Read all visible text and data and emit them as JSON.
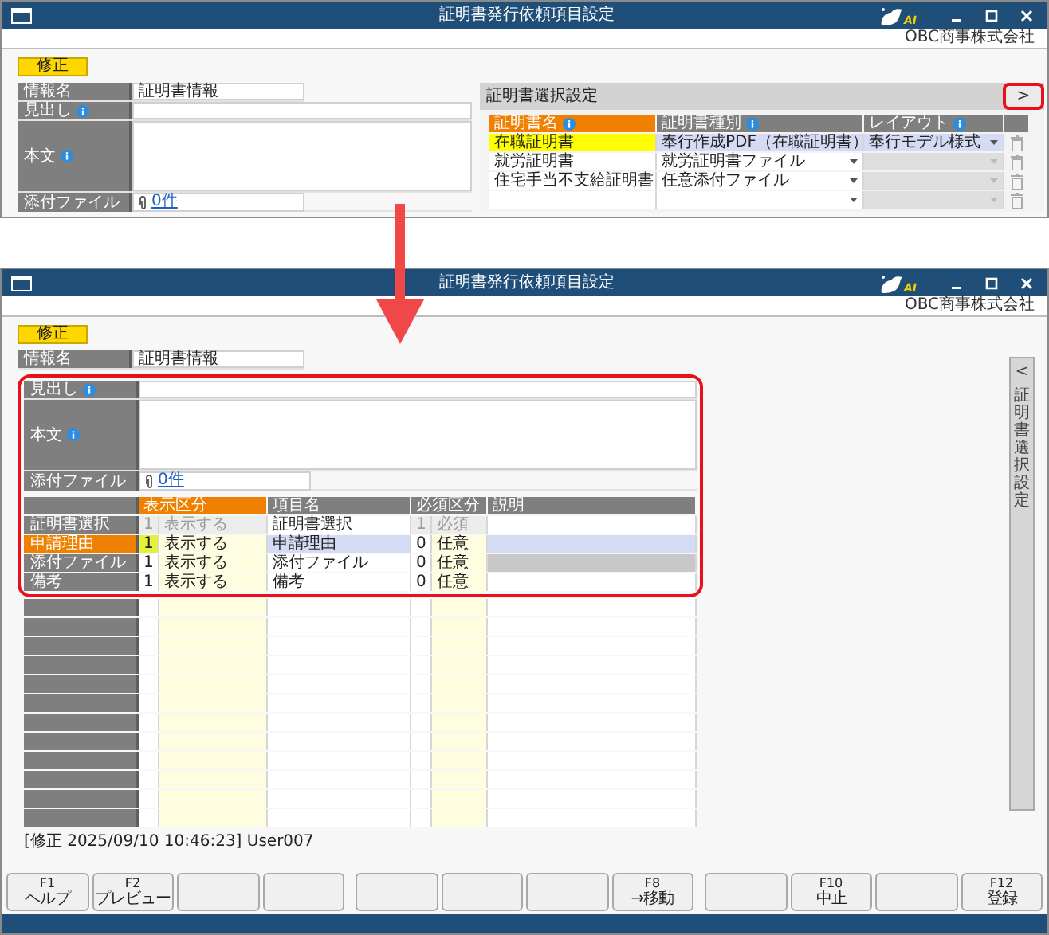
{
  "top_window": {
    "title": "証明書発行依頼項目設定",
    "ai_label": "AI",
    "company": "OBC商事株式会社",
    "mode": "修正",
    "fields": [
      {
        "kind": "name",
        "label": "情報名",
        "value": "証明書情報"
      },
      {
        "kind": "line",
        "label": "見出し",
        "info": true
      },
      {
        "kind": "memo",
        "label": "本文",
        "info": true
      },
      {
        "kind": "attachment",
        "label": "添付ファイル",
        "link": "0件"
      }
    ],
    "side_panel": {
      "title": "証明書選択設定",
      "toggle": ">",
      "toggle_highlighted": true,
      "columns": [
        {
          "label": "証明書名",
          "info": true,
          "selected": true
        },
        {
          "label": "証明書種別",
          "info": true,
          "selected": false
        },
        {
          "label": "レイアウト",
          "info": true,
          "selected": false
        }
      ],
      "rows": [
        {
          "name": "在職証明書",
          "type": "奉行作成PDF（在職証明書）",
          "layout": "奉行モデル様式",
          "selected": true,
          "layout_disabled": false
        },
        {
          "name": "就労証明書",
          "type": "就労証明書ファイル",
          "selected": false,
          "layout_disabled": true
        },
        {
          "name": "住宅手当不支給証明書",
          "type": "任意添付ファイル",
          "selected": false,
          "layout_disabled": true
        },
        {
          "selected": false,
          "layout_disabled": true
        }
      ]
    }
  },
  "bottom_window": {
    "title": "証明書発行依頼項目設定",
    "ai_label": "AI",
    "company": "OBC商事株式会社",
    "mode": "修正",
    "name_field": {
      "label": "情報名",
      "value": "証明書情報"
    },
    "detail_highlighted": true,
    "fields": [
      {
        "kind": "line",
        "label": "見出し",
        "info": true
      },
      {
        "kind": "memo",
        "label": "本文",
        "info": true
      },
      {
        "kind": "attachment",
        "label": "添付ファイル",
        "link": "0件"
      }
    ],
    "items_table": {
      "columns": [
        {
          "label": "表示区分",
          "selected": true
        },
        {
          "label": "項目名",
          "selected": false
        },
        {
          "label": "必須区分",
          "selected": false
        },
        {
          "label": "説明",
          "selected": false
        }
      ],
      "rows": [
        {
          "label": "証明書選択",
          "display_code": "1",
          "display": "表示する",
          "item": "証明書選択",
          "required_code": "1",
          "required": "必須",
          "selected": false,
          "disabled": true,
          "note_disabled": false
        },
        {
          "label": "申請理由",
          "display_code": "1",
          "display": "表示する",
          "item": "申請理由",
          "required_code": "0",
          "required": "任意",
          "selected": true,
          "disabled": false,
          "note_disabled": false
        },
        {
          "label": "添付ファイル",
          "display_code": "1",
          "display": "表示する",
          "item": "添付ファイル",
          "required_code": "0",
          "required": "任意",
          "selected": false,
          "disabled": false,
          "note_disabled": true
        },
        {
          "label": "備考",
          "display_code": "1",
          "display": "表示する",
          "item": "備考",
          "required_code": "0",
          "required": "任意",
          "selected": false,
          "disabled": false,
          "note_disabled": false
        }
      ]
    },
    "side_tab": {
      "toggle": "<",
      "label": "証明書選択設定"
    },
    "status": "[修正 2025/09/10 10:46:23] User007",
    "function_keys": [
      {
        "kind": "key",
        "key": "F1",
        "label": "ヘルプ"
      },
      {
        "kind": "key",
        "key": "F2",
        "label": "プレビュー"
      },
      {
        "kind": "blank"
      },
      {
        "kind": "blank"
      },
      {
        "kind": "blank"
      },
      {
        "kind": "blank"
      },
      {
        "kind": "blank"
      },
      {
        "kind": "key",
        "key": "F8",
        "label": "→移動"
      },
      {
        "kind": "blank"
      },
      {
        "kind": "key",
        "key": "F10",
        "label": "中止"
      },
      {
        "kind": "blank"
      },
      {
        "kind": "key",
        "key": "F12",
        "label": "登録"
      }
    ]
  }
}
